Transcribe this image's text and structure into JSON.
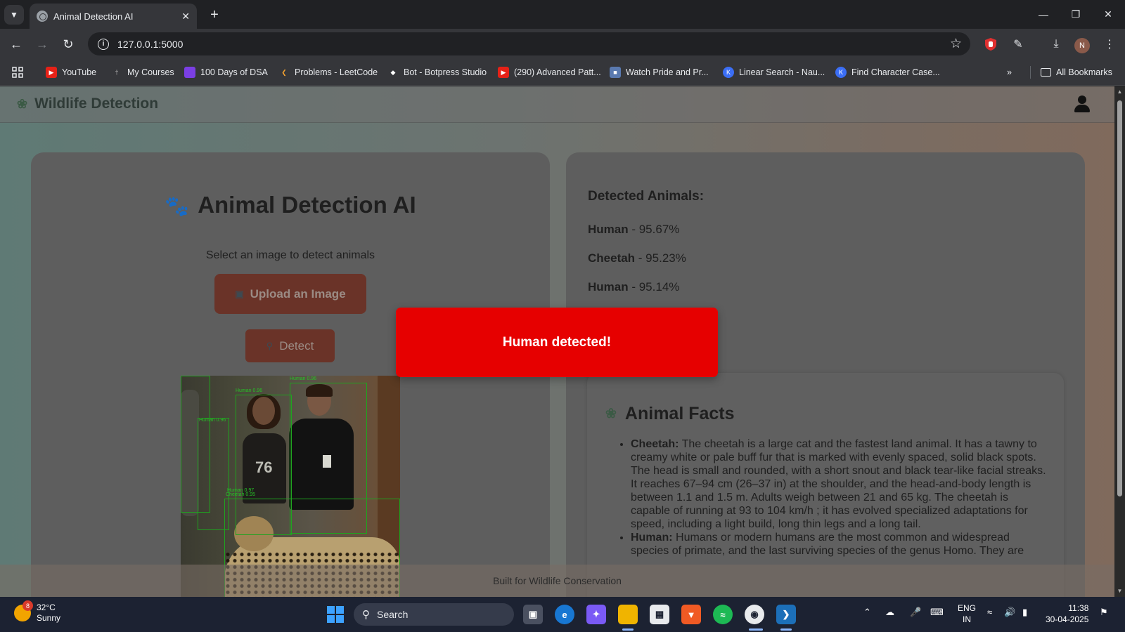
{
  "browser": {
    "tab_title": "Animal Detection AI",
    "url": "127.0.0.1:5000",
    "profile_initial": "N",
    "bookmarks": [
      {
        "label": "YouTube",
        "icon": "youtube-icon"
      },
      {
        "label": "My Courses",
        "icon": "courses-icon"
      },
      {
        "label": "100 Days of DSA",
        "icon": "dsa-icon"
      },
      {
        "label": "Problems - LeetCode",
        "icon": "leetcode-icon"
      },
      {
        "label": "Bot - Botpress Studio",
        "icon": "botpress-icon"
      },
      {
        "label": "(290) Advanced Patt...",
        "icon": "youtube-icon"
      },
      {
        "label": "Watch Pride and Pr...",
        "icon": "watch-icon"
      },
      {
        "label": "Linear Search - Nau...",
        "icon": "naukri-icon"
      },
      {
        "label": "Find Character Case...",
        "icon": "naukri-icon"
      }
    ],
    "all_bookmarks": "All Bookmarks"
  },
  "app": {
    "brand": "Wildlife Detection",
    "title": "Animal Detection AI",
    "subtitle": "Select an image to detect animals",
    "upload_label": "Upload an Image",
    "detect_label": "Detect",
    "detected_heading": "Detected Animals:",
    "detections": [
      {
        "name": "Human",
        "confidence": " - 95.67%"
      },
      {
        "name": "Cheetah",
        "confidence": " - 95.23%"
      },
      {
        "name": "Human",
        "confidence": " - 95.14%"
      }
    ],
    "box_labels": [
      "Human 0.96",
      "Human 0.96",
      "Human 0.96",
      "Human 0.97",
      "Cheetah 0.95"
    ],
    "facts_title": "Animal Facts",
    "facts": [
      {
        "name": "Cheetah:",
        "text": " The cheetah is a large cat and the fastest land animal. It has a tawny to creamy white or pale buff fur that is marked with evenly spaced, solid black spots. The head is small and rounded, with a short snout and black tear-like facial streaks. It reaches 67–94 cm (26–37 in) at the shoulder, and the head-and-body length is between 1.1 and 1.5 m. Adults weigh between 21 and 65 kg. The cheetah is capable of running at 93 to 104 km/h ; it has evolved specialized adaptations for speed, including a light build, long thin legs and a long tail."
      },
      {
        "name": "Human:",
        "text": " Humans or modern humans are the most common and widespread species of primate, and the last surviving species of the genus Homo. They are"
      }
    ],
    "footer": "Built for Wildlife Conservation",
    "toast": "Human detected!"
  },
  "taskbar": {
    "temp": "32°C",
    "weather": "Sunny",
    "weather_badge": "8",
    "search": "Search",
    "lang1": "ENG",
    "lang2": "IN",
    "time": "11:38",
    "date": "30-04-2025"
  },
  "colors": {
    "toast": "#e60000",
    "button": "#6a3328",
    "card": "#5e5e5e"
  }
}
